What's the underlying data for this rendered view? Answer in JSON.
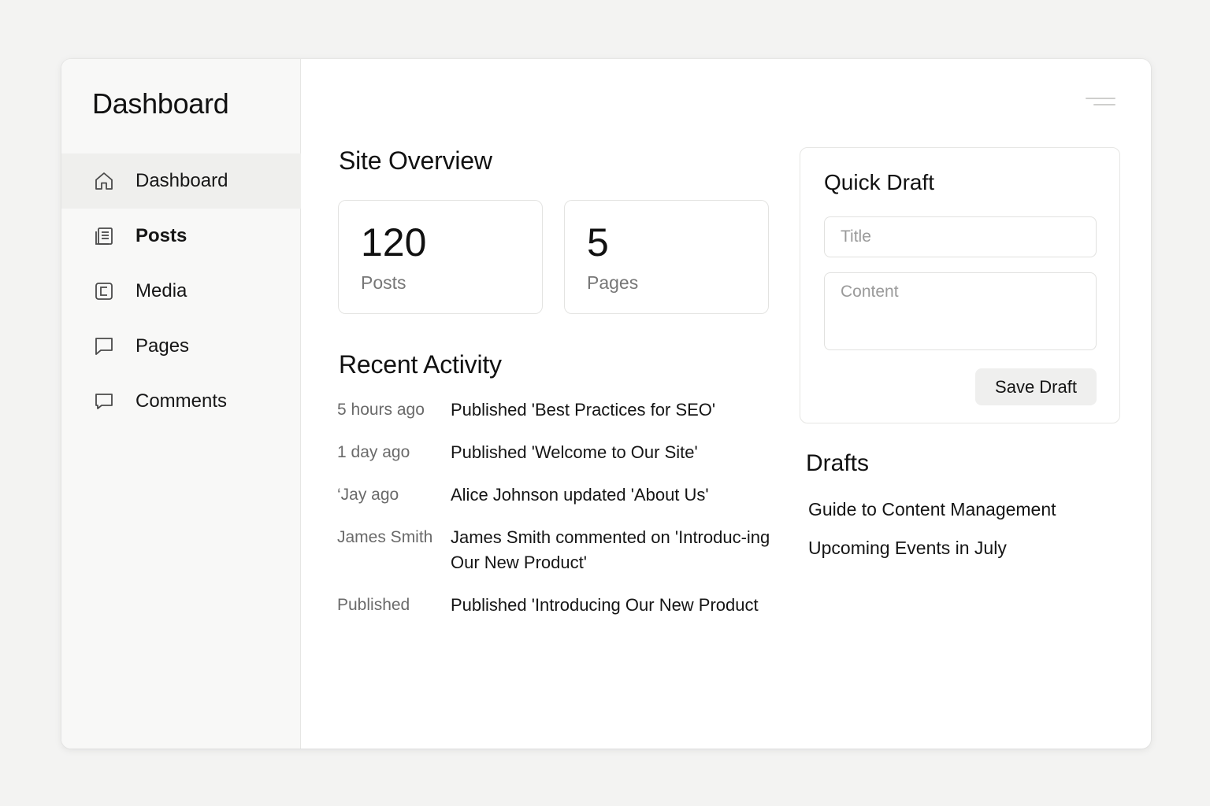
{
  "sidebar": {
    "brand": "Dashboard",
    "items": [
      {
        "label": "Dashboard",
        "icon": "home-icon",
        "active": true
      },
      {
        "label": "Posts",
        "icon": "posts-icon",
        "bold": true
      },
      {
        "label": "Media",
        "icon": "media-icon"
      },
      {
        "label": "Pages",
        "icon": "pages-icon"
      },
      {
        "label": "Comments",
        "icon": "comments-icon"
      }
    ]
  },
  "header": {
    "menu_icon": "menu-icon"
  },
  "overview": {
    "title": "Site Overview",
    "stats": [
      {
        "value": "120",
        "label": "Posts"
      },
      {
        "value": "5",
        "label": "Pages"
      }
    ]
  },
  "activity": {
    "title": "Recent Activity",
    "rows": [
      {
        "time": "5 hours ago",
        "text": "Published 'Best Practices for SEO'"
      },
      {
        "time": "1 day ago",
        "text": "Published 'Welcome to Our Site'"
      },
      {
        "time": "‘Jay ago",
        "text": "Alice Johnson updated 'About Us'"
      },
      {
        "time": "James Smith",
        "text": "James Smith commented on 'Introduc-ing Our New Product'"
      },
      {
        "time": "Published",
        "text": "Published 'Introducing Our New Product"
      }
    ]
  },
  "quick_draft": {
    "title": "Quick Draft",
    "title_placeholder": "Title",
    "content_placeholder": "Content",
    "save_label": "Save Draft"
  },
  "drafts": {
    "title": "Drafts",
    "items": [
      "Guide to Content Management",
      "Upcoming Events in July"
    ]
  },
  "colors": {
    "background": "#f3f3f2",
    "sidebar": "#f8f8f7",
    "active_item": "#efefed",
    "button": "#efefee"
  }
}
